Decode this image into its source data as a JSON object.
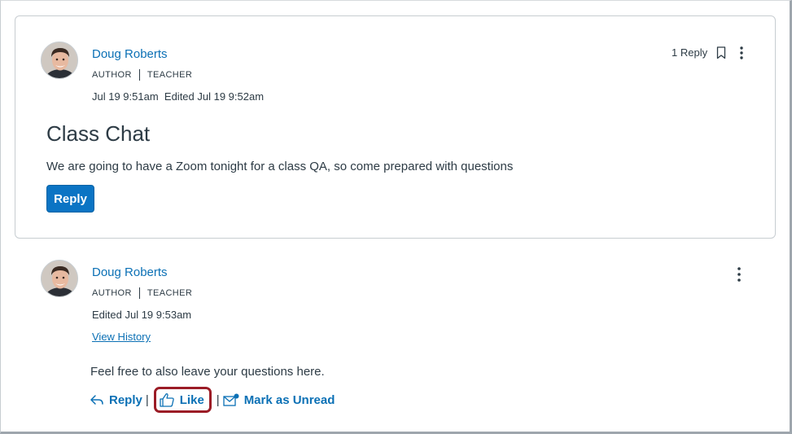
{
  "topic": {
    "author": "Doug Roberts",
    "role_primary": "AUTHOR",
    "role_secondary": "TEACHER",
    "timestamp": "Jul 19 9:51am",
    "edited": "Edited Jul 19 9:52am",
    "reply_count": "1 Reply",
    "title": "Class Chat",
    "message": "We are going to have a Zoom tonight for a class QA, so come prepared with questions",
    "reply_button": "Reply",
    "icons": {
      "bookmark": "bookmark-icon",
      "menu": "kebab-menu-icon"
    }
  },
  "entry": {
    "author": "Doug Roberts",
    "role_primary": "AUTHOR",
    "role_secondary": "TEACHER",
    "edited": "Edited Jul 19 9:53am",
    "view_history": "View History",
    "message": "Feel free to also leave your questions here.",
    "actions": {
      "reply": "Reply",
      "like": "Like",
      "mark_unread": "Mark as Unread"
    },
    "icons": {
      "reply": "reply-arrow-icon",
      "like": "thumbs-up-icon",
      "mark_unread": "envelope-dot-icon",
      "menu": "kebab-menu-icon"
    }
  },
  "colors": {
    "link": "#0b70b5",
    "primary_button": "#0b74c4",
    "text": "#2d3b45",
    "highlight": "#9b1c26",
    "border": "#c7cdd1"
  }
}
